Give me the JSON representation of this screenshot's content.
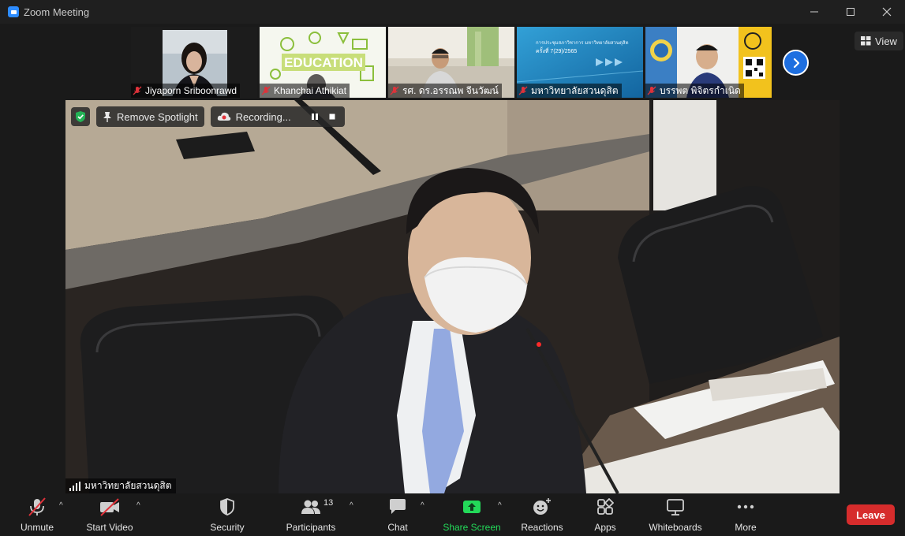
{
  "window": {
    "title": "Zoom Meeting"
  },
  "thumbnails": [
    {
      "name": "Jiyaporn Sriboonrawd"
    },
    {
      "name": "Khanchai Athikiat",
      "image_text": "EDUCATION"
    },
    {
      "name": "รศ. ดร.อรรณพ จีนวัฒน์"
    },
    {
      "name": "มหาวิทยาลัยสวนดุสิต",
      "slide_title": "การประชุมสภาวิชาการ มหาวิทยาลัยสวนดุสิต",
      "slide_subtitle": "ครั้งที่ 7(29)/2565"
    },
    {
      "name": "บรรพต พิจิตรกำเนิด"
    }
  ],
  "view_button": {
    "label": "View"
  },
  "spotlight": {
    "remove_label": "Remove Spotlight",
    "recording_label": "Recording..."
  },
  "main_video": {
    "name": "มหาวิทยาลัยสวนดุสิต"
  },
  "toolbar": {
    "unmute": "Unmute",
    "start_video": "Start Video",
    "security": "Security",
    "participants": "Participants",
    "participants_count": "13",
    "chat": "Chat",
    "share_screen": "Share Screen",
    "reactions": "Reactions",
    "apps": "Apps",
    "whiteboards": "Whiteboards",
    "more": "More",
    "leave": "Leave"
  },
  "colors": {
    "accent_blue": "#1e6fe0",
    "share_green": "#23d959",
    "leave_red": "#d62c2c",
    "mic_off_red": "#e0323a"
  }
}
